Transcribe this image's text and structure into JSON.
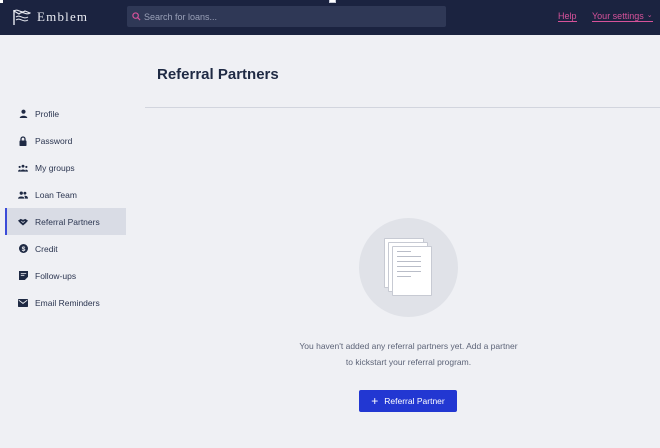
{
  "header": {
    "logo_text": "Emblem",
    "search_placeholder": "Search for loans...",
    "help_label": "Help",
    "settings_label": "Your settings"
  },
  "page": {
    "title": "Referral Partners"
  },
  "sidebar": {
    "items": [
      {
        "label": "Profile",
        "icon": "person-icon"
      },
      {
        "label": "Password",
        "icon": "lock-icon"
      },
      {
        "label": "My groups",
        "icon": "groups-icon"
      },
      {
        "label": "Loan Team",
        "icon": "team-icon"
      },
      {
        "label": "Referral Partners",
        "icon": "handshake-icon",
        "active": true
      },
      {
        "label": "Credit",
        "icon": "dollar-circle-icon"
      },
      {
        "label": "Follow-ups",
        "icon": "note-icon"
      },
      {
        "label": "Email Reminders",
        "icon": "mail-icon"
      }
    ]
  },
  "empty_state": {
    "message_line1": "You haven't added any referral partners yet. Add a partner",
    "message_line2": "to kickstart your referral program.",
    "button_label": "Referral Partner"
  },
  "colors": {
    "header_bg": "#1b2340",
    "accent_link": "#d6529a",
    "primary_button": "#2237d2",
    "active_indicator": "#3b4bd8"
  }
}
